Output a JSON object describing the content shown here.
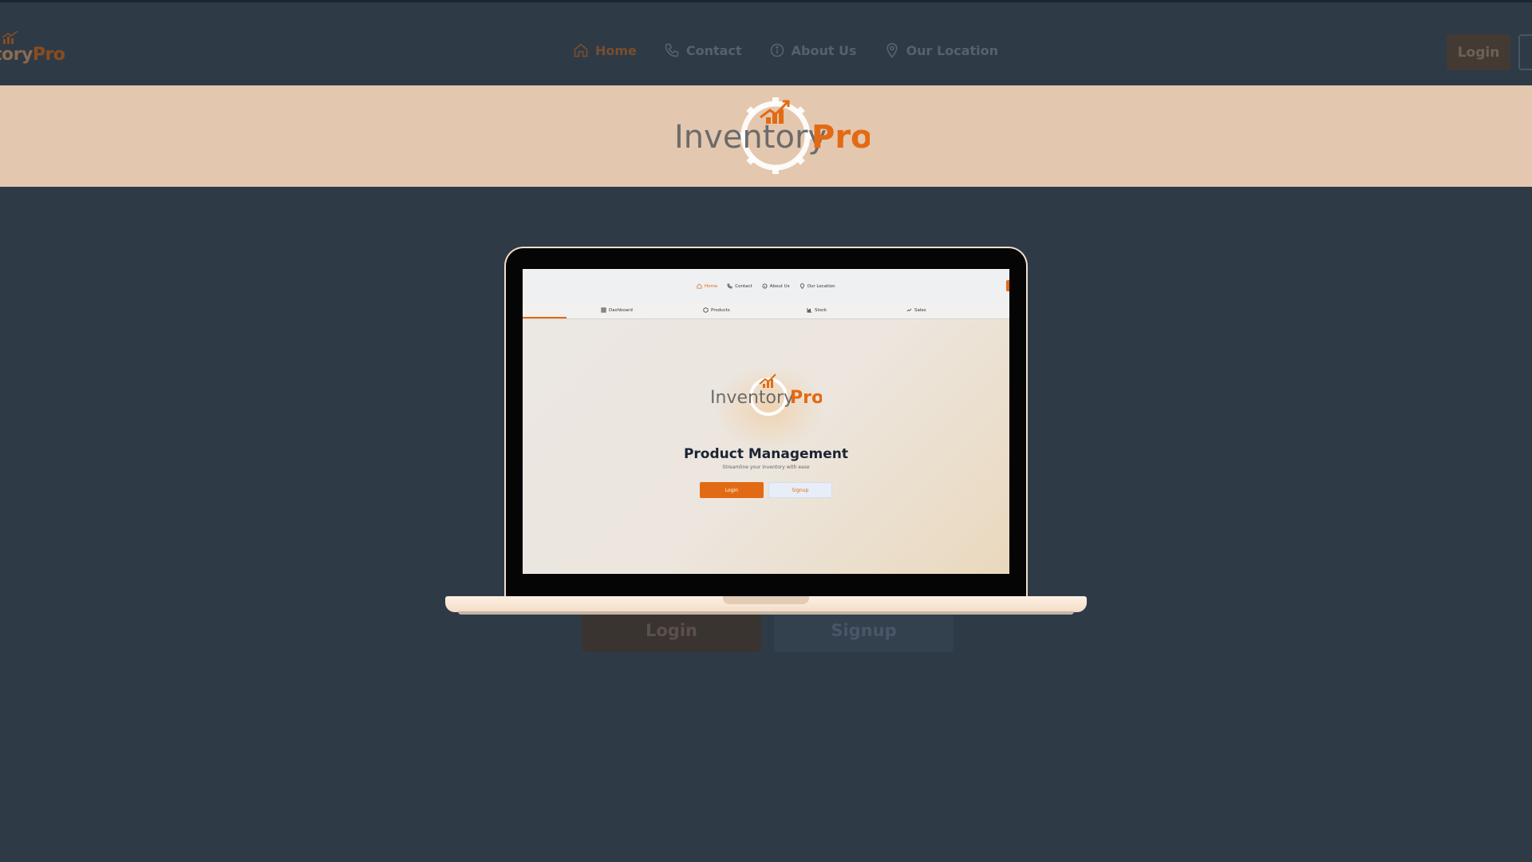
{
  "brand": {
    "name_part1": "Inventory",
    "name_part2": "Pro",
    "visible_fragment_1": "tory",
    "visible_fragment_2": "Pro"
  },
  "nav": {
    "items": [
      {
        "label": "Home",
        "icon": "home-icon",
        "active": true
      },
      {
        "label": "Contact",
        "icon": "phone-icon",
        "active": false
      },
      {
        "label": "About Us",
        "icon": "info-icon",
        "active": false
      },
      {
        "label": "Our Location",
        "icon": "map-pin-icon",
        "active": false
      }
    ],
    "login_label": "Login"
  },
  "hero_band": {
    "logo_text_1": "Inventory",
    "logo_text_2": "Pro"
  },
  "background_buttons": {
    "login_label": "Login",
    "signup_label": "Signup"
  },
  "laptop_screen": {
    "nav_items": [
      {
        "label": "Home",
        "active": true
      },
      {
        "label": "Contact"
      },
      {
        "label": "About Us"
      },
      {
        "label": "Our Location"
      }
    ],
    "tabs": [
      {
        "label": "Dashboard",
        "icon": "dashboard-icon"
      },
      {
        "label": "Products",
        "icon": "box-icon"
      },
      {
        "label": "Stock",
        "icon": "chart-icon"
      },
      {
        "label": "Sales",
        "icon": "trend-icon"
      }
    ],
    "logo_text_1": "Inventory",
    "logo_text_2": "Pro",
    "title": "Product Management",
    "subtitle": "Streamline your inventory with ease",
    "login_label": "Login",
    "signup_label": "Signup"
  },
  "colors": {
    "page_bg": "#2f3a47",
    "band_bg": "#e3c7ae",
    "accent_orange": "#e36a14",
    "logo_gray": "#6b6b6b"
  }
}
